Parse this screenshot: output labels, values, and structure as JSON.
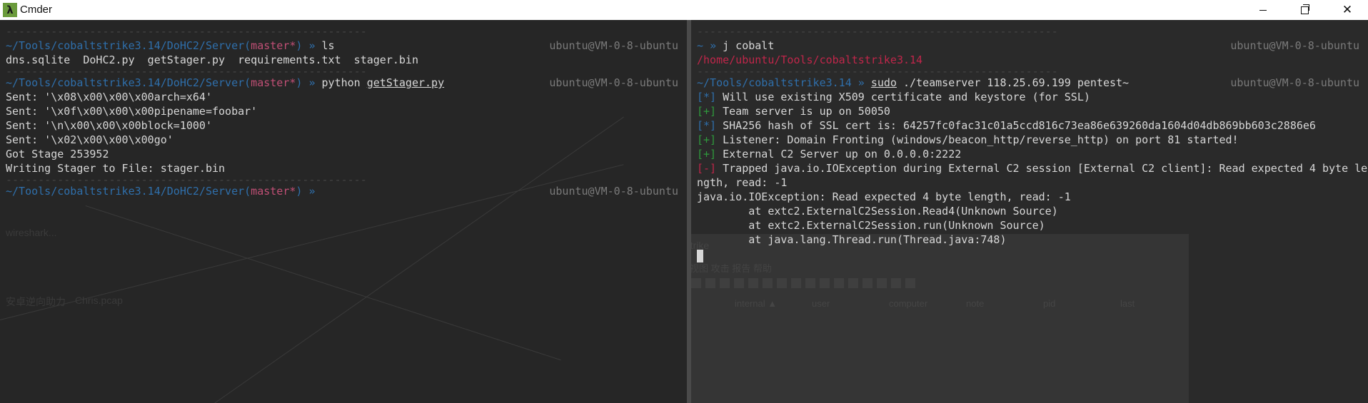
{
  "window": {
    "title": "Cmder",
    "icon": "lambda-icon",
    "controls": [
      "minimize",
      "maximize",
      "close"
    ]
  },
  "separator": "--------------------------------------------------------",
  "left_pane": {
    "host": "ubuntu@VM-0-8-ubuntu",
    "prompt1": {
      "path": "~/Tools/cobaltstrike3.14/DoHC2/Server",
      "branch": "master*",
      "arrow": "»",
      "command": "ls"
    },
    "ls_output": "dns.sqlite  DoHC2.py  getStager.py  requirements.txt  stager.bin",
    "prompt2": {
      "path": "~/Tools/cobaltstrike3.14/DoHC2/Server",
      "branch": "master*",
      "arrow": "»",
      "command": "python",
      "arg": "getStager.py"
    },
    "output": [
      "Sent: '\\x08\\x00\\x00\\x00arch=x64'",
      "Sent: '\\x0f\\x00\\x00\\x00pipename=foobar'",
      "Sent: '\\n\\x00\\x00\\x00block=1000'",
      "Sent: '\\x02\\x00\\x00\\x00go'",
      "Got Stage 253952",
      "Writing Stager to File: stager.bin"
    ],
    "prompt3": {
      "path": "~/Tools/cobaltstrike3.14/DoHC2/Server",
      "branch": "master*",
      "arrow": "»"
    }
  },
  "right_pane": {
    "host": "ubuntu@VM-0-8-ubuntu",
    "prompt1": {
      "path": "~",
      "arrow": "»",
      "command": "j cobalt"
    },
    "jump_output": "/home/ubuntu/Tools/cobaltstrike3.14",
    "prompt2": {
      "path": "~/Tools/cobaltstrike3.14",
      "arrow": "»",
      "sudo": "sudo",
      "command": "./teamserver 118.25.69.199 pentest~"
    },
    "log": [
      {
        "tag": "[*]",
        "kind": "info",
        "text": " Will use existing X509 certificate and keystore (for SSL)"
      },
      {
        "tag": "[+]",
        "kind": "ok",
        "text": " Team server is up on 50050"
      },
      {
        "tag": "[*]",
        "kind": "info",
        "text": " SHA256 hash of SSL cert is: 64257fc0fac31c01a5ccd816c73ea86e639260da1604d04db869bb603c2886e6"
      },
      {
        "tag": "[+]",
        "kind": "ok",
        "text": " Listener: Domain Fronting (windows/beacon_http/reverse_http) on port 81 started!"
      },
      {
        "tag": "[+]",
        "kind": "ok",
        "text": " External C2 Server up on 0.0.0.0:2222"
      },
      {
        "tag": "[-]",
        "kind": "err",
        "text": " Trapped java.io.IOException during External C2 session [External C2 client]: Read expected 4 byte le"
      }
    ],
    "wrap_line": "ngth, read: -1",
    "exception": [
      "java.io.IOException: Read expected 4 byte length, read: -1",
      "        at extc2.ExternalC2Session.Read4(Unknown Source)",
      "        at extc2.ExternalC2Session.run(Unknown Source)",
      "        at java.lang.Thread.run(Thread.java:748)"
    ]
  },
  "background": {
    "cs_window_title": "Cobalt Strike",
    "cs_menu": "Cobalt Strike   视图   攻击   报告   帮助",
    "cs_columns": [
      "external",
      "internal ▲",
      "user",
      "computer",
      "note",
      "pid",
      "last"
    ],
    "desktop_labels": [
      "wireshark...",
      "安卓逆向助力",
      "Chris.pcap"
    ]
  }
}
